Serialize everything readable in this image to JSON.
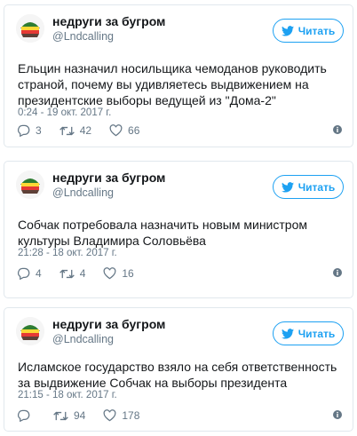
{
  "tweets": [
    {
      "display_name": "недруги за бугром",
      "screen_name": "@Lndcalling",
      "follow_label": "Читать",
      "text": "Ельцин назначил носильщика чемоданов руководить страной, почему вы удивляетесь выдвижением на президентские выборы ведущей из \"Дома-2\"",
      "timestamp": "0:24 - 19 окт. 2017 г.",
      "replies": "3",
      "retweets": "42",
      "likes": "66"
    },
    {
      "display_name": "недруги за бугром",
      "screen_name": "@Lndcalling",
      "follow_label": "Читать",
      "text": "Собчак потребовала назначить новым министром культуры Владимира Соловьёва",
      "timestamp": "21:28 - 18 окт. 2017 г.",
      "replies": "4",
      "retweets": "4",
      "likes": "16"
    },
    {
      "display_name": "недруги за бугром",
      "screen_name": "@Lndcalling",
      "follow_label": "Читать",
      "text": "Исламское государство взяло на себя ответственность за выдвижение Собчак на выборы президента",
      "timestamp": "21:15 - 18 окт. 2017 г.",
      "replies": "",
      "retweets": "94",
      "likes": "178"
    }
  ],
  "icons": {
    "reply": "reply-icon",
    "retweet": "retweet-icon",
    "like": "heart-icon",
    "info": "info-icon",
    "follow_bird": "twitter-bird-icon"
  },
  "colors": {
    "accent": "#1da1f2",
    "secondary_text": "#657786",
    "border": "#e1e8ed"
  }
}
